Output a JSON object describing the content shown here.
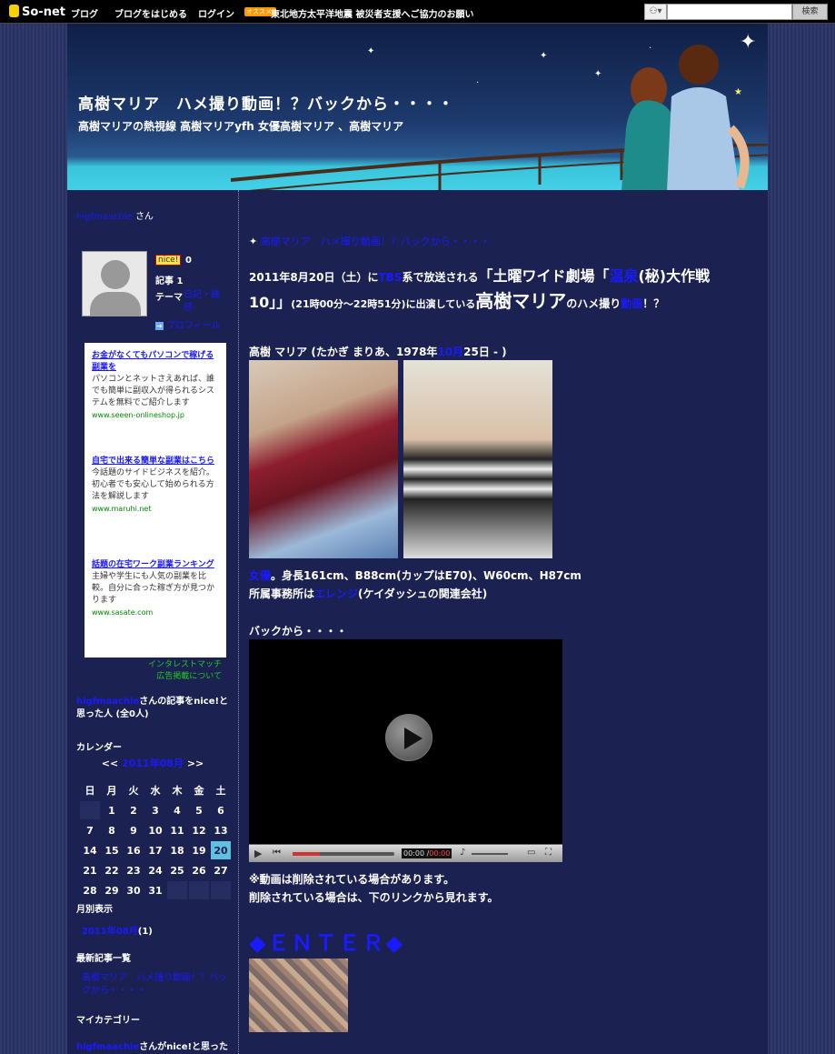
{
  "topbar": {
    "logo": "So-net",
    "blog_link": "ブログ",
    "start_link": "ブログをはじめる",
    "login_link": "ログイン",
    "rec_badge": "オススメ!",
    "notice": "東北地方太平洋地震 被災者支援へご協力のお願い",
    "search_icon_label": "⚇▾",
    "search_button": "検索"
  },
  "header": {
    "title": "高樹マリア　ハメ撮り動画！？バックから・・・・",
    "description": "高樹マリアの熱視線 高樹マリアyfh 女優高樹マリア 、高樹マリア"
  },
  "sidebar": {
    "user_name": "higfmaachie",
    "user_suffix": "さん",
    "nice_label": "nice!",
    "nice_count": "0",
    "articles": "記事 1",
    "theme_label": "テーマ",
    "theme_value": "日記・雑感",
    "profile_link": "プロフィール",
    "ads": [
      {
        "head": "お金がなくてもパソコンで稼げる副業を",
        "body": "パソコンとネットさえあれば、誰でも簡単に副収入が得られるシステムを無料でご紹介します",
        "url": "www.seeen-onlineshop.jp"
      },
      {
        "head": "自宅で出来る簡単な副業はこちら",
        "body": "今話題のサイドビジネスを紹介。初心者でも安心して始められる方法を解説します",
        "url": "www.maruhi.net"
      },
      {
        "head": "話題の在宅ワーク副業ランキング",
        "body": "主婦や学生にも人気の副業を比較。自分に合った稼ぎ方が見つかります",
        "url": "www.sasate.com"
      }
    ],
    "ad_link_interest": "インタレストマッチ",
    "ad_link_about": "広告掲載について",
    "nice_people_user": "higfmaachie",
    "nice_people_text": "さんの記事をnice!と思った人 (全0人)",
    "calendar_title": "カレンダー",
    "calendar_prev": "<<",
    "calendar_month": "2011年08月",
    "calendar_next": ">>",
    "weekdays": [
      "日",
      "月",
      "火",
      "水",
      "木",
      "金",
      "土"
    ],
    "weeks": [
      [
        "",
        "1",
        "2",
        "3",
        "4",
        "5",
        "6"
      ],
      [
        "7",
        "8",
        "9",
        "10",
        "11",
        "12",
        "13"
      ],
      [
        "14",
        "15",
        "16",
        "17",
        "18",
        "19",
        "20"
      ],
      [
        "21",
        "22",
        "23",
        "24",
        "25",
        "26",
        "27"
      ],
      [
        "28",
        "29",
        "30",
        "31",
        "",
        "",
        ""
      ]
    ],
    "today": "20",
    "archive_title": "月別表示",
    "archive_link": "2011年08月",
    "archive_count": "(1)",
    "recent_title": "最新記事一覧",
    "recent_link": "高樹マリア　ハメ撮り動画！？バックから・・・・",
    "category_title": "マイカテゴリー",
    "nice_articles_user": "higfmaachie",
    "nice_articles_text": "さんがnice!と思った記事"
  },
  "main": {
    "post_title": "高樹マリア　ハメ撮り動画！？バックから・・・・",
    "intro_a": "2011年8月20日（土）に",
    "intro_tv": "TBS",
    "intro_b": "系で放送される",
    "intro_show_a": "「土曜ワイド劇場「",
    "intro_show_link": "温泉",
    "intro_show_b": "(秘)大作戦",
    "intro_show_c": "10」」",
    "intro_time": "(21時00分～22時51分)に出演している",
    "intro_name": "高樹マリア",
    "intro_c": "のハメ撮り",
    "intro_video_link": "動画",
    "intro_d": "！？",
    "profile_a": "高樹 マリア (たかぎ まりあ、1978年",
    "profile_link": "10月",
    "profile_b": "25日 - )",
    "body_link": "女優",
    "body_text": "。身長161cm、B88cm(カップはE70)、W60cm、H87cm",
    "agency_a": "所属事務所は",
    "agency_link": "エレンジ",
    "agency_b": "(ケイダッシュの関連会社)",
    "back_text": "バックから・・・・",
    "video_time": "00:00 /",
    "video_duration": "00:00",
    "note1": "※動画は削除されている場合があります。",
    "note2": "削除されている場合は、下のリンクから見れます。",
    "enter": "◆ＥＮＴＥＲ◆"
  }
}
